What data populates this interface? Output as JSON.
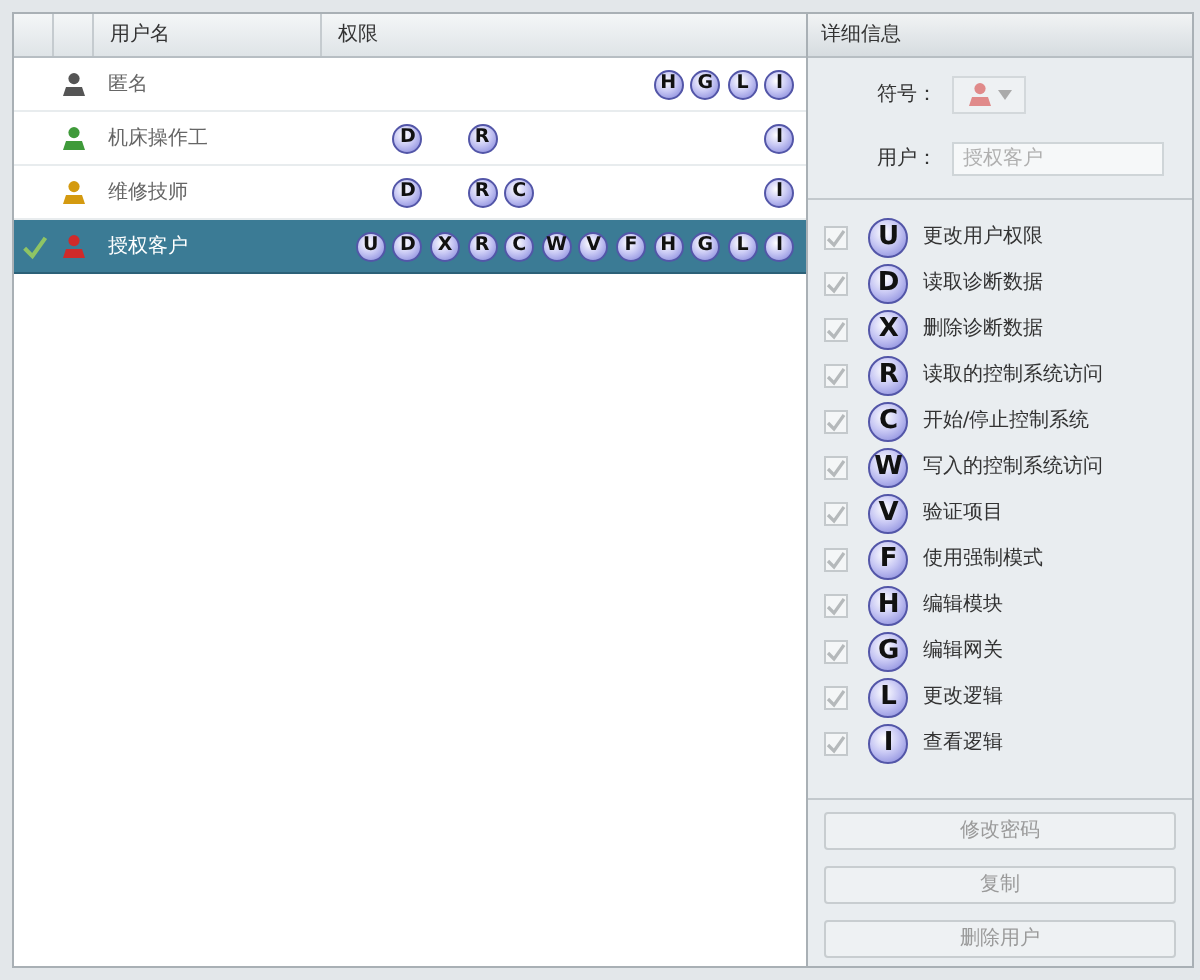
{
  "users_table": {
    "columns": [
      {
        "label": "用户名"
      },
      {
        "label": "权限"
      }
    ],
    "rows": [
      {
        "name": "匿名",
        "color": "#555555",
        "selected": false,
        "permissions": [
          {
            "granted": false
          },
          {
            "granted": false
          },
          {
            "granted": false
          },
          {
            "granted": false
          },
          {
            "granted": false
          },
          {
            "granted": false
          },
          {
            "granted": false
          },
          {
            "granted": false
          },
          {
            "granted": true,
            "code": "H"
          },
          {
            "granted": true,
            "code": "G"
          },
          {
            "granted": true,
            "code": "L"
          },
          {
            "granted": true,
            "code": "I"
          }
        ]
      },
      {
        "name": "机床操作工",
        "color": "#3f9a3a",
        "selected": false,
        "permissions": [
          {
            "granted": false
          },
          {
            "granted": true,
            "code": "D"
          },
          {
            "granted": false
          },
          {
            "granted": true,
            "code": "R"
          },
          {
            "granted": false
          },
          {
            "granted": false
          },
          {
            "granted": false
          },
          {
            "granted": false
          },
          {
            "granted": false
          },
          {
            "granted": false
          },
          {
            "granted": false
          },
          {
            "granted": true,
            "code": "I"
          }
        ]
      },
      {
        "name": "维修技师",
        "color": "#d49a10",
        "selected": false,
        "permissions": [
          {
            "granted": false
          },
          {
            "granted": true,
            "code": "D"
          },
          {
            "granted": false
          },
          {
            "granted": true,
            "code": "R"
          },
          {
            "granted": true,
            "code": "C"
          },
          {
            "granted": false
          },
          {
            "granted": false
          },
          {
            "granted": false
          },
          {
            "granted": false
          },
          {
            "granted": false
          },
          {
            "granted": false
          },
          {
            "granted": true,
            "code": "I"
          }
        ]
      },
      {
        "name": "授权客户",
        "color": "#d02a2a",
        "selected": true,
        "permissions": [
          {
            "granted": true,
            "code": "U"
          },
          {
            "granted": true,
            "code": "D"
          },
          {
            "granted": true,
            "code": "X"
          },
          {
            "granted": true,
            "code": "R"
          },
          {
            "granted": true,
            "code": "C"
          },
          {
            "granted": true,
            "code": "W"
          },
          {
            "granted": true,
            "code": "V"
          },
          {
            "granted": true,
            "code": "F"
          },
          {
            "granted": true,
            "code": "H"
          },
          {
            "granted": true,
            "code": "G"
          },
          {
            "granted": true,
            "code": "L"
          },
          {
            "granted": true,
            "code": "I"
          }
        ]
      }
    ]
  },
  "details": {
    "title": "详细信息",
    "symbol": {
      "label": "符号：",
      "color": "#e08a8a",
      "disabled": true
    },
    "user": {
      "label": "用户：",
      "value": "授权客户",
      "disabled": true
    },
    "permissions": [
      {
        "code": "U",
        "label": "更改用户权限",
        "checked": true
      },
      {
        "code": "D",
        "label": "读取诊断数据",
        "checked": true
      },
      {
        "code": "X",
        "label": "删除诊断数据",
        "checked": true
      },
      {
        "code": "R",
        "label": "读取的控制系统访问",
        "checked": true
      },
      {
        "code": "C",
        "label": "开始/停止控制系统",
        "checked": true
      },
      {
        "code": "W",
        "label": "写入的控制系统访问",
        "checked": true
      },
      {
        "code": "V",
        "label": "验证项目",
        "checked": true
      },
      {
        "code": "F",
        "label": "使用强制模式",
        "checked": true
      },
      {
        "code": "H",
        "label": "编辑模块",
        "checked": true
      },
      {
        "code": "G",
        "label": "编辑网关",
        "checked": true
      },
      {
        "code": "L",
        "label": "更改逻辑",
        "checked": true
      },
      {
        "code": "I",
        "label": "查看逻辑",
        "checked": true
      }
    ],
    "buttons": [
      {
        "label": "修改密码",
        "disabled": true
      },
      {
        "label": "复制",
        "disabled": true
      },
      {
        "label": "删除用户",
        "disabled": true
      }
    ]
  }
}
